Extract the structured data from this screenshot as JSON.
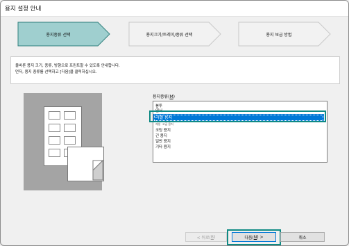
{
  "window": {
    "title": "용지 설정 안내"
  },
  "steps": [
    {
      "label": "용지종류 선택",
      "active": true
    },
    {
      "label": "용지크기/트레이/종류 선택",
      "active": false
    },
    {
      "label": "용지 보급 방법",
      "active": false
    }
  ],
  "instructions": {
    "line1": "올바른 용지 크기, 종류, 방향으로 프린트할 수 있도록 안내합니다.",
    "line2": "먼저, 용지 종류를 선택하고 [다음]을 클릭하십시오."
  },
  "paper_type": {
    "label": "용지종류",
    "hotkey": "M",
    "items": [
      "봉투",
      "엽서",
      "라벨 용지",
      "코팅 용지",
      "긴 용지",
      "일반 용지",
      "기타 용지"
    ],
    "partial_item": "재생 ·고급 용지",
    "selected": "라벨 용지"
  },
  "buttons": {
    "back": {
      "text": "< 뒤로(",
      "hotkey": "B",
      "end": ")"
    },
    "next": {
      "text": "다음(",
      "hotkey": "N",
      "end": ") >"
    },
    "cancel": "취소"
  },
  "colors": {
    "active_step": "#9fcfcf",
    "inactive_step": "#f2f2f2",
    "highlight": "#0f8a84",
    "selection": "#0078d7"
  }
}
